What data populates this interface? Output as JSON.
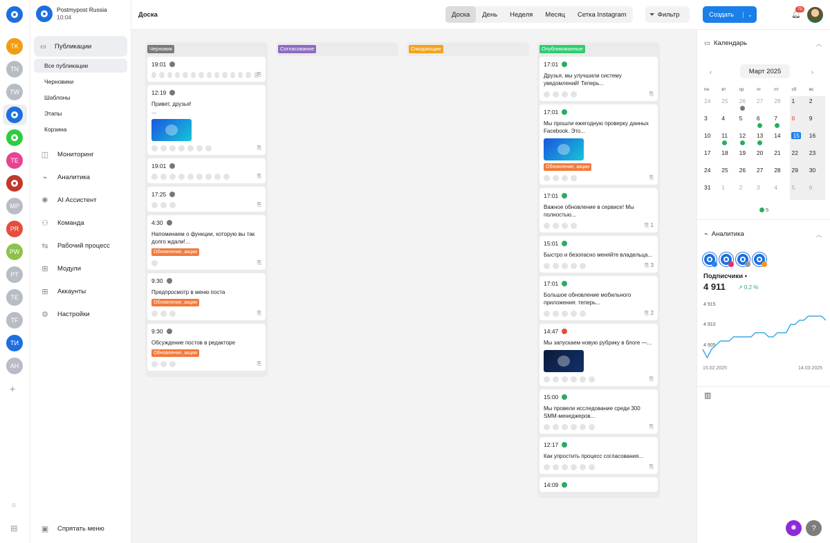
{
  "workspace": {
    "name": "Postmypost Russia",
    "time": "10:04"
  },
  "accounts": [
    {
      "initials": "TK",
      "color": "#f39c12"
    },
    {
      "initials": "TN",
      "color": "#b8bcc4"
    },
    {
      "initials": "TW",
      "color": "#b8bcc4"
    },
    {
      "initials": "",
      "color": "#1d6fe0"
    },
    {
      "initials": "",
      "color": "#2ecc40"
    },
    {
      "initials": "TE",
      "color": "#e84393"
    },
    {
      "initials": "",
      "color": "#c0392b"
    },
    {
      "initials": "MP",
      "color": "#b8bcc4"
    },
    {
      "initials": "PR",
      "color": "#e74c3c"
    },
    {
      "initials": "PW",
      "color": "#8bc34a"
    },
    {
      "initials": "PT",
      "color": "#b8bcc4"
    },
    {
      "initials": "TE",
      "color": "#b8bcc4"
    },
    {
      "initials": "TF",
      "color": "#b8bcc4"
    },
    {
      "initials": "ТИ",
      "color": "#1d6fe0"
    },
    {
      "initials": "AH",
      "color": "#b8bcc4"
    }
  ],
  "menu": {
    "publications": "Публикации",
    "sub": [
      "Все публикации",
      "Черновики",
      "Шаблоны",
      "Этапы",
      "Корзина"
    ],
    "items": [
      "Мониторинг",
      "Аналитика",
      "AI Ассистент",
      "Команда",
      "Рабочий процесс",
      "Модули",
      "Аккаунты",
      "Настройки"
    ],
    "hide": "Спрятать меню"
  },
  "topbar": {
    "title": "Доска",
    "views": [
      "Доска",
      "День",
      "Неделя",
      "Месяц",
      "Сетка Instagram"
    ],
    "filter": "Фильтр",
    "create": "Создать",
    "notifications": "70"
  },
  "columns": [
    {
      "label": "Черновик",
      "color": "#7a7a7a",
      "cards": [
        {
          "time": "19:01",
          "dot": "#777777",
          "text": "",
          "tag": "",
          "image": "",
          "nets": 14,
          "comments": ""
        },
        {
          "time": "12:19",
          "dot": "#777777",
          "text": "Привет, друзья!\n...",
          "tag": "",
          "image": "blue",
          "nets": 7,
          "comments": ""
        },
        {
          "time": "19:01",
          "dot": "#777777",
          "text": "",
          "tag": "",
          "image": "",
          "nets": 9,
          "comments": ""
        },
        {
          "time": "17:25",
          "dot": "#777777",
          "text": "",
          "tag": "",
          "image": "",
          "nets": 3,
          "comments": ""
        },
        {
          "time": "4:30",
          "dot": "#777777",
          "text": "Напоминаем о функции, которую вы так долго ждали!...",
          "tag": "Обновление, акции",
          "image": "",
          "nets": 1,
          "comments": ""
        },
        {
          "time": "9:30",
          "dot": "#777777",
          "text": "Предпросмотр в меню поста",
          "tag": "Обновление, акции",
          "image": "",
          "nets": 3,
          "comments": ""
        },
        {
          "time": "9:30",
          "dot": "#777777",
          "text": "Обсуждение постов в редакторе",
          "tag": "Обновление, акции",
          "image": "",
          "nets": 3,
          "comments": ""
        }
      ]
    },
    {
      "label": "Согласование",
      "color": "#8e6bc4",
      "cards": []
    },
    {
      "label": "Ожидающие",
      "color": "#f2a21b",
      "cards": []
    },
    {
      "label": "Опубликованные",
      "color": "#2ecc71",
      "cards": [
        {
          "time": "17:01",
          "dot": "#27ae60",
          "text": "Друзья, мы улучшили систему уведомлений! Теперь...",
          "tag": "",
          "image": "",
          "nets": 4,
          "comments": ""
        },
        {
          "time": "17:01",
          "dot": "#27ae60",
          "text": "Мы прошли ежегодную проверку данных Facebook. Это...",
          "tag": "Обновление, акции",
          "image": "blue",
          "nets": 4,
          "comments": ""
        },
        {
          "time": "17:01",
          "dot": "#27ae60",
          "text": "Важное обновление в сервисе! Мы полностью...",
          "tag": "",
          "image": "",
          "nets": 4,
          "comments": "1"
        },
        {
          "time": "15:01",
          "dot": "#27ae60",
          "text": "Быстро и безопасно меняйте владельца...",
          "tag": "",
          "image": "",
          "nets": 5,
          "comments": "3"
        },
        {
          "time": "17:01",
          "dot": "#27ae60",
          "text": "Большое обновление мобильного приложения: теперь...",
          "tag": "",
          "image": "",
          "nets": 5,
          "comments": "2"
        },
        {
          "time": "14:47",
          "dot": "#e74c3c",
          "text": "Мы запускаем новую рубрику в блоге —...",
          "tag": "",
          "image": "dark",
          "nets": 6,
          "comments": ""
        },
        {
          "time": "15:00",
          "dot": "#27ae60",
          "text": "Мы провели исследование среди 300 SMM-менеджеров...",
          "tag": "",
          "image": "",
          "nets": 6,
          "comments": ""
        },
        {
          "time": "12:17",
          "dot": "#27ae60",
          "text": "Как упростить процесс согласования...",
          "tag": "",
          "image": "",
          "nets": 6,
          "comments": ""
        },
        {
          "time": "14:09",
          "dot": "#27ae60",
          "text": "",
          "tag": "",
          "image": "",
          "nets": 0,
          "comments": ""
        }
      ]
    }
  ],
  "calendar": {
    "title": "Календарь",
    "month": "Март 2025",
    "weekdays": [
      "пн",
      "вт",
      "ср",
      "чт",
      "пт",
      "сб",
      "вс"
    ],
    "days": [
      {
        "n": "24",
        "m": true
      },
      {
        "n": "25",
        "m": true
      },
      {
        "n": "26",
        "m": true,
        "mark": "#777777"
      },
      {
        "n": "27",
        "m": true
      },
      {
        "n": "28",
        "m": true
      },
      {
        "n": "1",
        "we": true
      },
      {
        "n": "2",
        "we": true
      },
      {
        "n": "3"
      },
      {
        "n": "4"
      },
      {
        "n": "5"
      },
      {
        "n": "6",
        "mark": "#27ae60"
      },
      {
        "n": "7",
        "mark": "#27ae60"
      },
      {
        "n": "8",
        "we": true,
        "red": true
      },
      {
        "n": "9",
        "we": true
      },
      {
        "n": "10"
      },
      {
        "n": "11",
        "mark": "#27ae60"
      },
      {
        "n": "12",
        "mark": "#27ae60"
      },
      {
        "n": "13",
        "mark": "#27ae60"
      },
      {
        "n": "14"
      },
      {
        "n": "15",
        "we": true,
        "today": true
      },
      {
        "n": "16",
        "we": true
      },
      {
        "n": "17"
      },
      {
        "n": "18"
      },
      {
        "n": "19"
      },
      {
        "n": "20"
      },
      {
        "n": "21"
      },
      {
        "n": "22",
        "we": true
      },
      {
        "n": "23",
        "we": true
      },
      {
        "n": "24"
      },
      {
        "n": "25"
      },
      {
        "n": "26"
      },
      {
        "n": "27"
      },
      {
        "n": "28"
      },
      {
        "n": "29",
        "we": true
      },
      {
        "n": "30",
        "we": true
      },
      {
        "n": "31"
      },
      {
        "n": "1",
        "m": true
      },
      {
        "n": "2",
        "m": true
      },
      {
        "n": "3",
        "m": true
      },
      {
        "n": "4",
        "m": true
      },
      {
        "n": "5",
        "m": true,
        "we": true
      },
      {
        "n": "6",
        "m": true,
        "we": true
      }
    ],
    "legend_count": "5"
  },
  "analytics": {
    "title": "Аналитика",
    "label": "Подписчики •",
    "value": "4 911",
    "delta": "↗ 0,2 %",
    "y_ticks": [
      "4 915",
      "4 910",
      "4 905"
    ],
    "x_start": "15.02.2025",
    "x_end": "14.03.2025"
  },
  "chart_data": {
    "type": "line",
    "x": [
      "15.02.2025",
      "14.03.2025"
    ],
    "series": [
      {
        "values": [
          4905,
          4903,
          4905,
          4906,
          4907,
          4907,
          4907,
          4908,
          4908,
          4908,
          4908,
          4908,
          4909,
          4909,
          4909,
          4908,
          4908,
          4909,
          4909,
          4909,
          4911,
          4911,
          4912,
          4912,
          4913,
          4913,
          4913,
          4913,
          4912
        ]
      }
    ],
    "ylim": [
      4902,
      4917
    ]
  }
}
